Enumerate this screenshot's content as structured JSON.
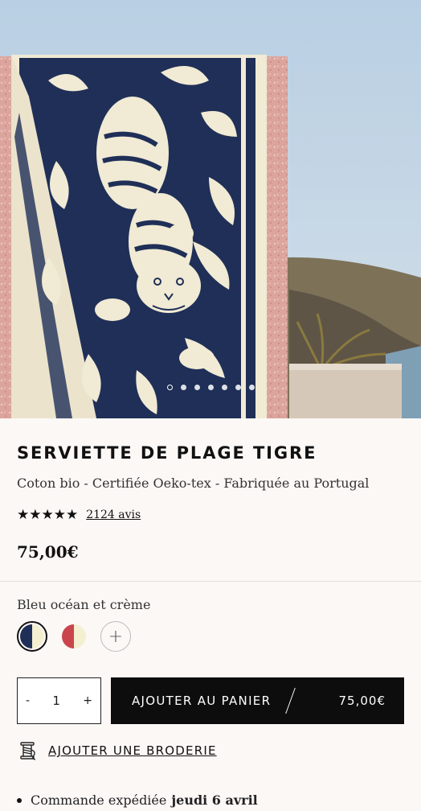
{
  "gallery": {
    "slide_count": 7,
    "active_slide": 1,
    "image_subject": "tiger-towel-on-wall"
  },
  "product": {
    "title": "SERVIETTE DE PLAGE TIGRE",
    "subtitle": "Coton bio - Certifiée Oeko-tex - Fabriquée au Portugal",
    "stars": "★★★★★",
    "rating": 5,
    "reviews_label": "2124 avis",
    "price": "75,00€"
  },
  "variants": {
    "selected_name": "Bleu océan et crème",
    "swatches": [
      {
        "name": "bleu-ocean-creme",
        "colors": [
          "#1f2f57",
          "#f4efd0"
        ],
        "selected": true
      },
      {
        "name": "rouge-creme",
        "colors": [
          "#c9454b",
          "#f4efd0"
        ],
        "selected": false
      }
    ],
    "more_symbol": "+"
  },
  "quantity": {
    "minus": "-",
    "value": "1",
    "plus": "+"
  },
  "cart": {
    "label": "AJOUTER AU PANIER",
    "amount": "75,00€"
  },
  "embroidery": {
    "label": "AJOUTER UNE BRODERIE"
  },
  "shipping": {
    "prefix": "Commande expédiée",
    "date": "jeudi 6 avril"
  },
  "colors": {
    "background": "#fcf8f6",
    "navy": "#1f2f57",
    "cream": "#f4efd0",
    "button": "#0d0d0d"
  }
}
